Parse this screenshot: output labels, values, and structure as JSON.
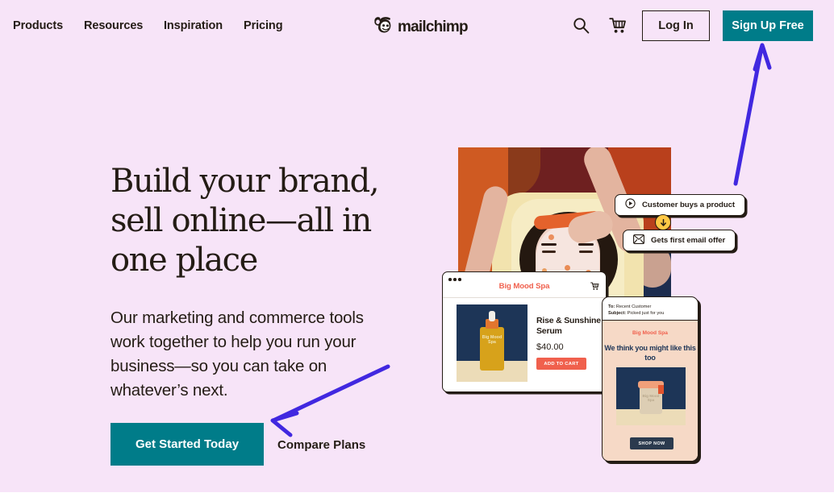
{
  "colors": {
    "page_background": "#f7e4f8",
    "teal_accent": "#007c89",
    "ink": "#241c15",
    "annotation_arrow": "#4128e0",
    "coral": "#f0604d",
    "navy": "#1d3557",
    "yellow": "#ffc845"
  },
  "header": {
    "nav": [
      {
        "label": "Products",
        "name": "nav-link-products"
      },
      {
        "label": "Resources",
        "name": "nav-link-resources"
      },
      {
        "label": "Inspiration",
        "name": "nav-link-inspiration"
      },
      {
        "label": "Pricing",
        "name": "nav-link-pricing"
      }
    ],
    "logo": {
      "wordmark": "mailchimp",
      "icon": "freddie-monkey-icon"
    },
    "icons": {
      "search": "search-icon",
      "cart": "shopping-cart-icon"
    },
    "login_label": "Log In",
    "signup_label": "Sign Up Free"
  },
  "hero": {
    "heading": "Build your brand, sell online—all in one place",
    "heading_lines": [
      "Build your",
      "brand, sell online",
      "—all in one place"
    ],
    "subheading": "Our marketing and commerce tools work together to help you run your business—so you can take on whatever’s next.",
    "primary_cta": "Get Started Today",
    "secondary_cta": "Compare Plans"
  },
  "automation_cards": [
    {
      "label": "Customer buys a product",
      "icon": "play-circle-icon"
    },
    {
      "label": "Gets first email offer",
      "icon": "envelope-icon"
    }
  ],
  "automation_connector_icon": "arrow-down-circle-icon",
  "store_card": {
    "store_name": "Big Mood Spa",
    "cart_icon": "shopping-cart-icon",
    "product_name": "Rise & Sunshine Serum",
    "price": "$40.00",
    "add_to_cart_label": "ADD TO CART",
    "product_image_label": "Big Mood Spa"
  },
  "email_card": {
    "to_label": "To:",
    "to_value": "Recent Customer",
    "subject_label": "Subject:",
    "subject_value": "Picked just for you",
    "brand": "Big Mood Spa",
    "headline": "We think you might like this too",
    "headline_lines": [
      "We think you",
      "might like this too"
    ],
    "shop_now_label": "SHOP NOW",
    "product_image_label": "Big Mood Spa"
  },
  "annotations": [
    {
      "name": "arrow-to-signup-button",
      "points_to": "Sign Up Free",
      "color": "#4128e0"
    },
    {
      "name": "arrow-to-get-started-button",
      "points_to": "Get Started Today",
      "color": "#4128e0"
    }
  ]
}
